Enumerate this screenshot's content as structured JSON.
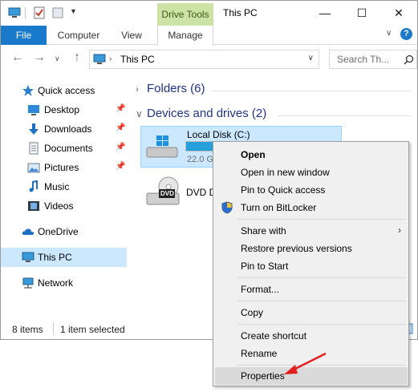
{
  "window": {
    "title": "This PC",
    "contextual_tab_group": "Drive Tools",
    "minimize": "—",
    "maximize": "☐",
    "close": "✕"
  },
  "ribbon": {
    "tabs": [
      "File",
      "Computer",
      "View",
      "Manage"
    ],
    "collapse": "∨",
    "help": "?"
  },
  "address": {
    "path": "This PC",
    "dropdown": "∨",
    "search_placeholder": "Search Th..."
  },
  "nav": {
    "items": [
      {
        "label": "Quick access",
        "icon": "star-icon"
      },
      {
        "label": "Desktop",
        "icon": "desktop-icon",
        "pinned": true
      },
      {
        "label": "Downloads",
        "icon": "download-icon",
        "pinned": true
      },
      {
        "label": "Documents",
        "icon": "documents-icon",
        "pinned": true
      },
      {
        "label": "Pictures",
        "icon": "pictures-icon",
        "pinned": true
      },
      {
        "label": "Music",
        "icon": "music-icon"
      },
      {
        "label": "Videos",
        "icon": "videos-icon"
      },
      {
        "label": "OneDrive",
        "icon": "cloud-icon"
      },
      {
        "label": "This PC",
        "icon": "computer-icon",
        "selected": true
      },
      {
        "label": "Network",
        "icon": "network-icon"
      }
    ]
  },
  "content": {
    "folders_header": "Folders (6)",
    "devices_header": "Devices and drives (2)",
    "drives": [
      {
        "name": "Local Disk (C:)",
        "free_text": "22.0 G",
        "used_fraction": 0.45
      },
      {
        "name": "DVD D",
        "icon_label": "DVD"
      }
    ]
  },
  "status": {
    "item_count": "8 items",
    "selection": "1 item selected"
  },
  "context_menu": {
    "items": [
      "Open",
      "Open in new window",
      "Pin to Quick access",
      "Turn on BitLocker",
      "Share with",
      "Restore previous versions",
      "Pin to Start",
      "Format...",
      "Copy",
      "Create shortcut",
      "Rename",
      "Properties"
    ]
  },
  "colors": {
    "accent": "#1979ca",
    "selection": "#cce8ff",
    "drive_tools": "#cde2a5",
    "arrow": "#e0201f"
  }
}
